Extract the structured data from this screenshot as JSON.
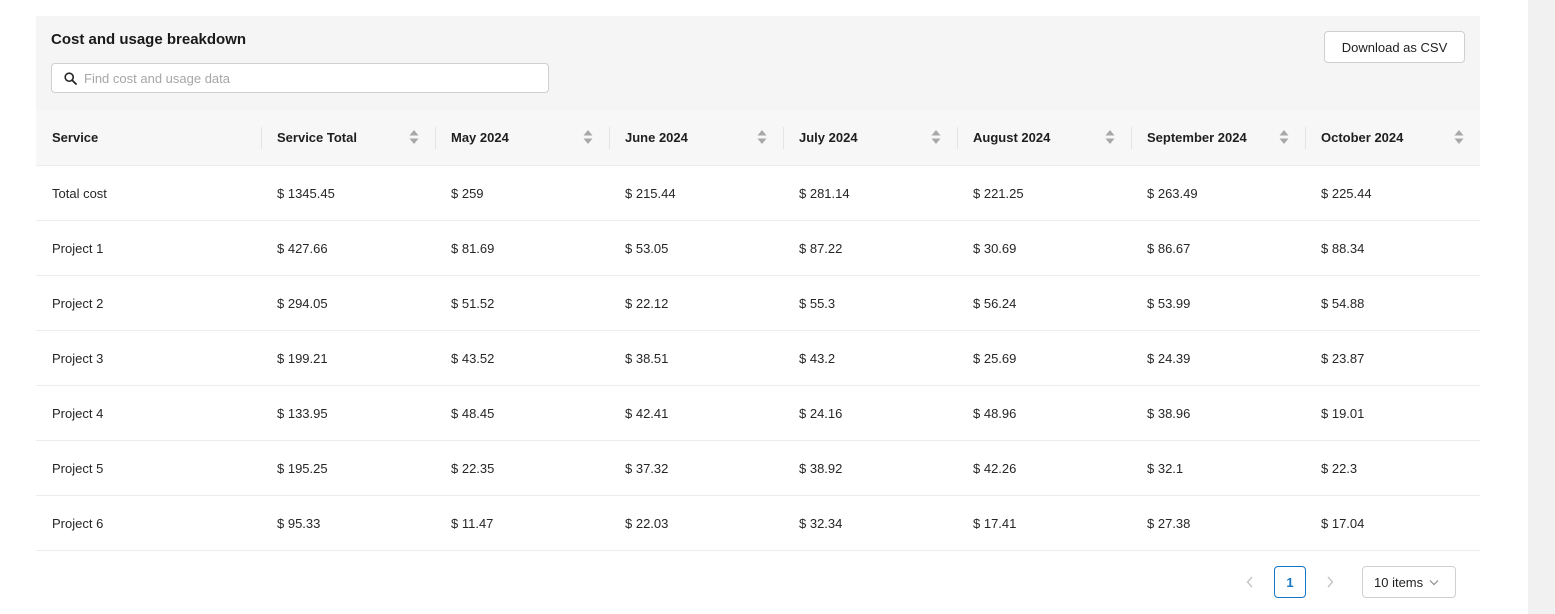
{
  "card": {
    "title": "Cost and usage breakdown",
    "search_placeholder": "Find cost and usage data",
    "download_label": "Download as CSV"
  },
  "table": {
    "columns": [
      "Service",
      "Service Total",
      "May 2024",
      "June 2024",
      "July 2024",
      "August 2024",
      "September 2024",
      "October 2024"
    ],
    "rows": [
      [
        "Total cost",
        "$ 1345.45",
        "$ 259",
        "$ 215.44",
        "$ 281.14",
        "$ 221.25",
        "$ 263.49",
        "$ 225.44"
      ],
      [
        "Project 1",
        "$ 427.66",
        "$ 81.69",
        "$ 53.05",
        "$ 87.22",
        "$ 30.69",
        "$ 86.67",
        "$ 88.34"
      ],
      [
        "Project 2",
        "$ 294.05",
        "$ 51.52",
        "$ 22.12",
        "$ 55.3",
        "$ 56.24",
        "$ 53.99",
        "$ 54.88"
      ],
      [
        "Project 3",
        "$ 199.21",
        "$ 43.52",
        "$ 38.51",
        "$ 43.2",
        "$ 25.69",
        "$ 24.39",
        "$ 23.87"
      ],
      [
        "Project 4",
        "$ 133.95",
        "$ 48.45",
        "$ 42.41",
        "$ 24.16",
        "$ 48.96",
        "$ 38.96",
        "$ 19.01"
      ],
      [
        "Project 5",
        "$ 195.25",
        "$ 22.35",
        "$ 37.32",
        "$ 38.92",
        "$ 42.26",
        "$ 32.1",
        "$ 22.3"
      ],
      [
        "Project 6",
        "$ 95.33",
        "$ 11.47",
        "$ 22.03",
        "$ 32.34",
        "$ 17.41",
        "$ 27.38",
        "$ 17.04"
      ]
    ]
  },
  "pagination": {
    "current_page": "1",
    "page_size": "10 items"
  },
  "icons": {
    "search": "search-icon",
    "sort": "sort-icon",
    "prev": "chevron-left-icon",
    "next": "chevron-right-icon",
    "dropdown": "chevron-down-icon"
  },
  "colors": {
    "accent": "#1677c5",
    "header_bg": "#f5f5f5"
  }
}
